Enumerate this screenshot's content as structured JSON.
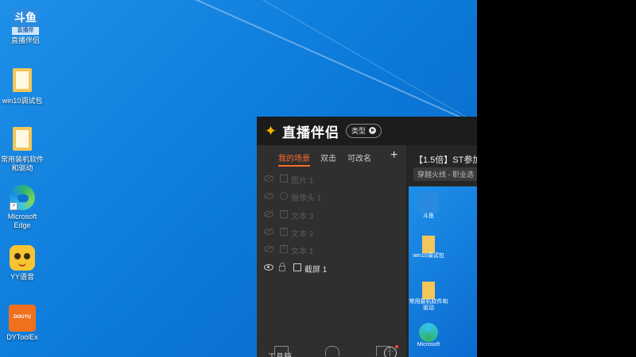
{
  "desktop": {
    "icons": [
      {
        "label_lines": [
          "斗鱼",
          "直播伴侣"
        ],
        "glyph": "douyu-icon",
        "badge": "斗鱼",
        "sub": "直播伴"
      },
      {
        "label_lines": [
          "win10调试包"
        ],
        "glyph": "folder-icon"
      },
      {
        "label_lines": [
          "常用装机软件",
          "和驱动"
        ],
        "glyph": "folder-icon"
      },
      {
        "label_lines": [
          "Microsoft",
          "Edge"
        ],
        "glyph": "edge-icon"
      },
      {
        "label_lines": [
          "YY语音"
        ],
        "glyph": "yy-icon"
      },
      {
        "label_lines": [
          "DYToolEx"
        ],
        "glyph": "dytool-icon",
        "badge": "DOUYU"
      }
    ]
  },
  "app": {
    "title": "直播伴侣",
    "type_pill": "类型",
    "tabs": [
      "我的场景",
      "双击",
      "可改名"
    ],
    "add_label": "+",
    "layers": [
      {
        "name": "图片 1",
        "type_icon": "image-icon"
      },
      {
        "name": "摄像头 1",
        "type_icon": "camera-icon"
      },
      {
        "name": "文本 3",
        "type_icon": "text-icon"
      },
      {
        "name": "文本 2",
        "type_icon": "text-icon"
      },
      {
        "name": "文本 1",
        "type_icon": "text-icon"
      },
      {
        "name": "截屏 1",
        "type_icon": "screenshot-icon",
        "visible": true
      }
    ],
    "toolbox_label": "工具箱",
    "more_label": "···",
    "stream_title": "【1.5倍】ST参加",
    "stream_category": "穿越火线 - 职业选",
    "preview_icons": [
      "斗鱼",
      "win10调试包",
      "常用装机软件和驱动",
      "Microsoft"
    ]
  }
}
